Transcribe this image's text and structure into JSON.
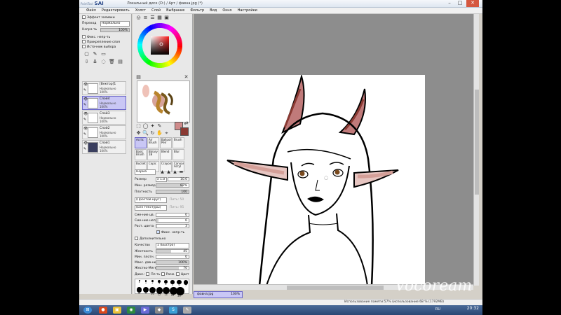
{
  "app": {
    "logo_text": "SAI",
    "logo_small": "PaintTool",
    "title": "Локальный диск (D:) / Арт / фавна.jpg (*)"
  },
  "menu": [
    "Файл",
    "Редактировать",
    "Холст",
    "Слой",
    "Выбрание",
    "Фильтр",
    "Вид",
    "Окно",
    "Настройки"
  ],
  "layers_panel": {
    "fill_effect_label": "Эффект заливки",
    "blend_label": "Переход",
    "blend_value": "Нормально",
    "opacity_label": "Непрз-ть",
    "opacity_value": "100%",
    "opacity_fraction": 1.0,
    "options": [
      "Фикс. непр-ть",
      "Прикрепление слоя",
      "Источник выбора"
    ],
    "layers": [
      {
        "name": "[Вектор]1",
        "mode": "Нормально",
        "pct": "100%",
        "active": false
      },
      {
        "name": "Слой4",
        "mode": "Нормально",
        "pct": "100%",
        "active": true
      },
      {
        "name": "Слой3",
        "mode": "Нормально",
        "pct": "100%",
        "active": false
      },
      {
        "name": "Слой2",
        "mode": "Нормально",
        "pct": "100%",
        "active": false
      },
      {
        "name": "Слой1",
        "mode": "Нормально",
        "pct": "100%",
        "active": false
      }
    ]
  },
  "tools_panel": {
    "primary_color": "#cf8b8b",
    "secondary_color": "#8a3a33",
    "brushes": [
      [
        "Acrlic",
        "Air Brush",
        "Ballpoint Pen",
        "Brush"
      ],
      [
        "Basic Brush",
        "Binary 1B",
        "Blend",
        "Blur"
      ],
      [
        "Bucket",
        "Copic",
        "Crayon",
        "Canvas Acryl"
      ]
    ],
    "mode_label": "Норма",
    "size_label": "Размер",
    "size_mult": "x 1.0",
    "size_value": "10.0",
    "min_size_label": "Мин. размер",
    "min_size_value": "82%",
    "min_size_fraction": 0.82,
    "density_label": "Плотность",
    "density_value": "100",
    "density_fraction": 1.0,
    "shape_select": "(Простой круг)",
    "shape_strength": "Пить: 50",
    "texture_select": "(Без текстуры)",
    "texture_strength": "Пить: 95",
    "mix_label": "Сме-ние цв.",
    "mix_value": "0",
    "mix_fraction": 0.0,
    "mix2_label": "Сме-ние непр.",
    "mix2_value": "6",
    "mix2_fraction": 0.06,
    "stretch_label": "Раст. цвета",
    "stretch_value": "3",
    "stretch_fraction": 0.03,
    "fix_opacity": "Фикс. непр-ть",
    "advanced_label": "Дополнительно",
    "quality_label": "Качество",
    "quality_value": "1 (Быстро)",
    "hardness_label": "Жесткость",
    "hardness_value": "45",
    "hardness_fraction": 0.45,
    "min_density_label": "Мин. плотн.",
    "min_density_value": "0",
    "min_density_fraction": 0.0,
    "max_pressure_label": "Макс. дав-ние",
    "max_pressure_value": "100%",
    "max_pressure_fraction": 1.0,
    "hard_soft_label": "Жестко-Мягко",
    "hard_soft_value": "70",
    "hard_soft_fraction": 0.7,
    "pressure_label": "Давл.:",
    "pressure_opts": [
      "Пл-ть",
      "Разм.",
      "Цвет"
    ],
    "brush_sizes": [
      "1",
      "1",
      "2",
      "3",
      "4",
      "5",
      "6",
      "7",
      "8",
      "9",
      "10",
      "12",
      "14",
      "16",
      "20"
    ]
  },
  "document": {
    "tab_name": "фавна.jpg",
    "tab_zoom": "100%"
  },
  "status": {
    "text": "Использование памяти:57% (использование:68 % (1792MB)"
  },
  "taskbar": {
    "lang": "RU",
    "time": "20:32"
  },
  "watermark": {
    "text": "Vocoream"
  }
}
